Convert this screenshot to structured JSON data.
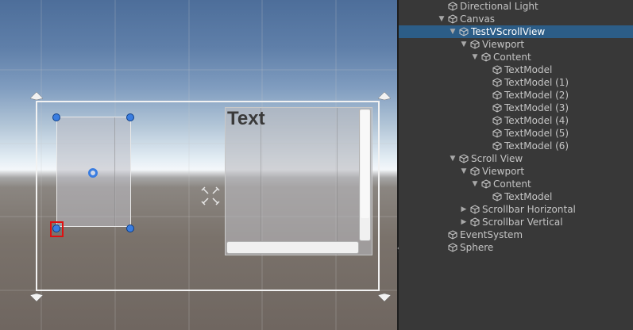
{
  "scene": {
    "text_label": "Text"
  },
  "hierarchy": {
    "rows": [
      {
        "label": "Directional Light",
        "depth": 0,
        "arrow": "none"
      },
      {
        "label": "Canvas",
        "depth": 0,
        "arrow": "expanded"
      },
      {
        "label": "TestVScrollView",
        "depth": 1,
        "arrow": "expanded",
        "selected": true
      },
      {
        "label": "Viewport",
        "depth": 2,
        "arrow": "expanded"
      },
      {
        "label": "Content",
        "depth": 3,
        "arrow": "expanded"
      },
      {
        "label": "TextModel",
        "depth": 4,
        "arrow": "none"
      },
      {
        "label": "TextModel (1)",
        "depth": 4,
        "arrow": "none"
      },
      {
        "label": "TextModel (2)",
        "depth": 4,
        "arrow": "none"
      },
      {
        "label": "TextModel (3)",
        "depth": 4,
        "arrow": "none"
      },
      {
        "label": "TextModel (4)",
        "depth": 4,
        "arrow": "none"
      },
      {
        "label": "TextModel (5)",
        "depth": 4,
        "arrow": "none"
      },
      {
        "label": "TextModel (6)",
        "depth": 4,
        "arrow": "none"
      },
      {
        "label": "Scroll View",
        "depth": 1,
        "arrow": "expanded"
      },
      {
        "label": "Viewport",
        "depth": 2,
        "arrow": "expanded"
      },
      {
        "label": "Content",
        "depth": 3,
        "arrow": "expanded"
      },
      {
        "label": "TextModel",
        "depth": 4,
        "arrow": "none"
      },
      {
        "label": "Scrollbar Horizontal",
        "depth": 2,
        "arrow": "collapsed"
      },
      {
        "label": "Scrollbar Vertical",
        "depth": 2,
        "arrow": "collapsed"
      },
      {
        "label": "EventSystem",
        "depth": 0,
        "arrow": "none"
      },
      {
        "label": "Sphere",
        "depth": 0,
        "arrow": "none"
      }
    ]
  },
  "colors": {
    "selection": "#2c5d87",
    "handle": "#3a7de0",
    "highlight_box": "#e01010"
  }
}
